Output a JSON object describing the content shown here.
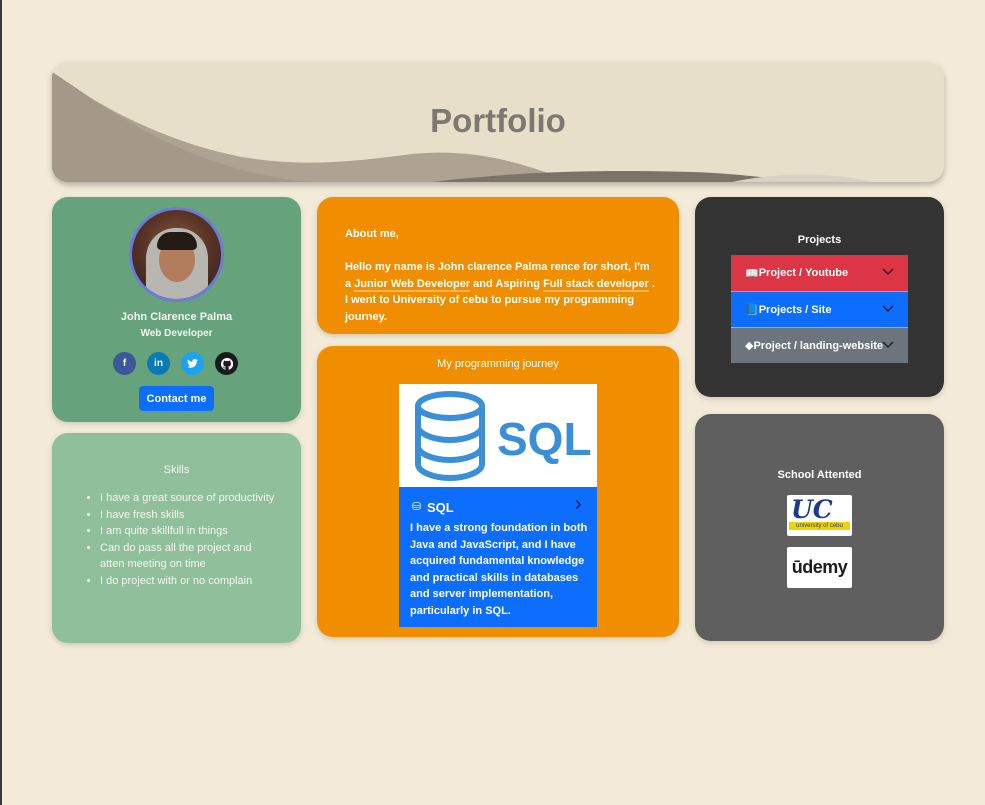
{
  "header": {
    "title": "Portfolio"
  },
  "profile": {
    "name": "John Clarence Palma",
    "role": "Web Developer",
    "socials": [
      {
        "name": "facebook-icon",
        "glyph": "f"
      },
      {
        "name": "linkedin-icon",
        "glyph": "in"
      },
      {
        "name": "twitter-icon",
        "glyph": "t"
      },
      {
        "name": "github-icon",
        "glyph": "gh"
      }
    ],
    "contact_label": "Contact me"
  },
  "skills": {
    "title": "Skills",
    "items": [
      "I have a great source of productivity",
      "I have fresh skills",
      "I am quite skillfull in things",
      "Can do pass all the project and atten meeting on time",
      "I do project with or no complain"
    ]
  },
  "about": {
    "heading": "About me,",
    "text_1": "Hello my name is John clarence Palma rence for short, I'm a ",
    "highlight_1": "Junior Web Developer",
    "text_2": " and Aspiring ",
    "highlight_2": "Full stack developer",
    "text_3": " . I went to University of cebu to pursue my programming journey."
  },
  "journey": {
    "title": "My programming journey",
    "card_title": "SQL",
    "card_text": "I have a strong foundation in both Java and JavaScript, and I have acquired fundamental knowledge and practical skills in databases and server implementation, particularly in SQL.",
    "image_label": "SQL"
  },
  "projects": {
    "title": "Projects",
    "items": [
      {
        "label": "Project / Youtube",
        "color": "#dc3545"
      },
      {
        "label": "Projects / Site",
        "color": "#0d6efd"
      },
      {
        "label": "Project / landing-website",
        "color": "#6c757d"
      }
    ]
  },
  "school": {
    "title": "School Attented",
    "logos": [
      {
        "name": "uc-logo",
        "letters": "UC",
        "subtitle": "university of cebu"
      },
      {
        "name": "udemy-logo",
        "text": "ūdemy"
      }
    ]
  }
}
